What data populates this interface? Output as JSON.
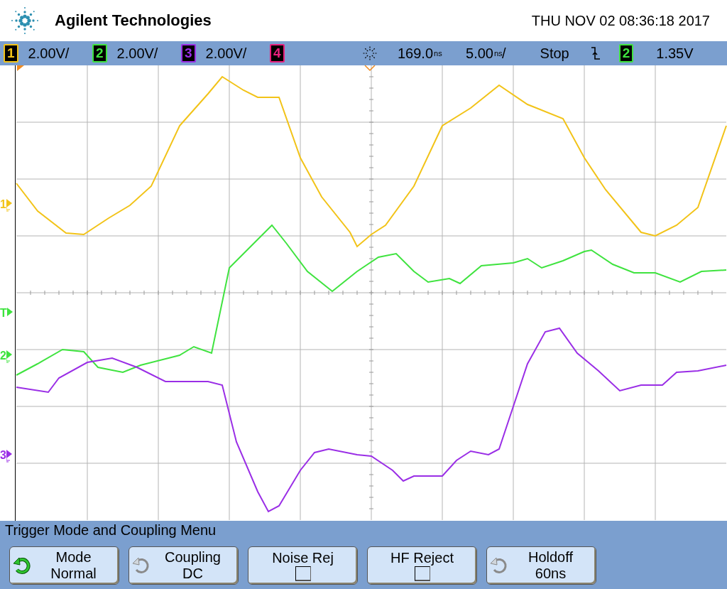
{
  "header": {
    "brand": "Agilent Technologies",
    "datetime": "THU NOV 02 08:36:18 2017"
  },
  "channels": [
    {
      "number": "1",
      "scale": "2.00V/",
      "color": "#f2c318"
    },
    {
      "number": "2",
      "scale": "2.00V/",
      "color": "#3fe33f"
    },
    {
      "number": "3",
      "scale": "2.00V/",
      "color": "#9a2ee6"
    },
    {
      "number": "4",
      "color": "#e8207c"
    }
  ],
  "timebase": {
    "delay": "169.0",
    "delay_unit": "ns",
    "scale": "5.00",
    "scale_unit": "ns",
    "scale_suffix": "/"
  },
  "run_state": "Stop",
  "trigger": {
    "source": "2",
    "color": "#3fe33f",
    "level": "1.35V"
  },
  "markers": [
    {
      "label": "1",
      "color": "#f2c318",
      "kind": "ground"
    },
    {
      "label": "T",
      "color": "#3fe33f",
      "kind": "trigger"
    },
    {
      "label": "2",
      "color": "#3fe33f",
      "kind": "ground"
    },
    {
      "label": "3",
      "color": "#9a2ee6",
      "kind": "ground"
    }
  ],
  "menu": {
    "title": "Trigger Mode and Coupling Menu",
    "softkeys": [
      {
        "kind": "rotary",
        "label": "Mode",
        "value": "Normal",
        "active": true
      },
      {
        "kind": "rotary",
        "label": "Coupling",
        "value": "DC",
        "active": false
      },
      {
        "kind": "checkbox",
        "label": "Noise Rej",
        "checked": false
      },
      {
        "kind": "checkbox",
        "label": "HF Reject",
        "checked": false
      },
      {
        "kind": "rotary",
        "label": "Holdoff",
        "value": "60ns",
        "active": false
      }
    ]
  }
}
